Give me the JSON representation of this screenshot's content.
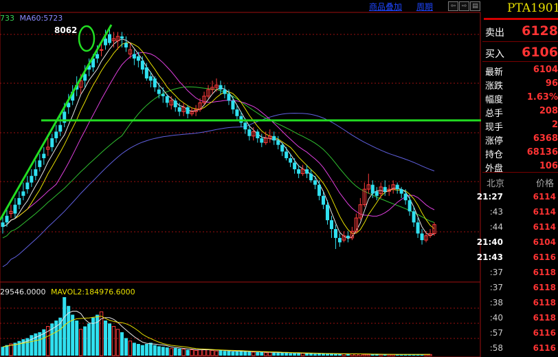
{
  "topbar": {
    "overlay_label": "商品叠加",
    "period_label": "周期",
    "buttons": [
      "⇦",
      "⇨",
      "▤"
    ]
  },
  "price_panel": {
    "ma_legend": {
      "ma_fragment": "733",
      "ma60": "MA60:5723",
      "ma_fragment_color": "#39d353",
      "ma60_color": "#8a8aff"
    },
    "high_label": "8062",
    "horizontal_level_color": "#22dd22"
  },
  "volume_panel": {
    "legend": {
      "vol_fragment": "29546.0000",
      "mavol2": "MAVOL2:184976.6000"
    }
  },
  "sidebar": {
    "symbol": "PTA1901",
    "sell": {
      "label": "卖出",
      "value": "6128"
    },
    "buy": {
      "label": "买入",
      "value": "6106"
    },
    "stats": [
      {
        "label": "最新",
        "value": "6104"
      },
      {
        "label": "涨跌",
        "value": "96"
      },
      {
        "label": "幅度",
        "value": "1.63%"
      },
      {
        "label": "总手",
        "value": "208"
      },
      {
        "label": "现手",
        "value": "2"
      },
      {
        "label": "涨停",
        "value": "6368"
      },
      {
        "label": "持仓",
        "value": "68136"
      },
      {
        "label": "外盘",
        "value": "106"
      }
    ],
    "ticks_header": {
      "left": "北京",
      "right": "价格"
    },
    "ticks": [
      {
        "time": "21:27",
        "price": "6114",
        "bold": true
      },
      {
        "time": ":43",
        "price": "6114",
        "bold": false
      },
      {
        "time": ":44",
        "price": "6114",
        "bold": false
      },
      {
        "time": "21:40",
        "price": "6104",
        "bold": true
      },
      {
        "time": "21:43",
        "price": "6116",
        "bold": true
      },
      {
        "time": ":37",
        "price": "6118",
        "bold": false
      },
      {
        "time": ":37",
        "price": "6118",
        "bold": false
      },
      {
        "time": ":38",
        "price": "6118",
        "bold": false
      },
      {
        "time": ":40",
        "price": "6118",
        "bold": false
      },
      {
        "time": ":57",
        "price": "6116",
        "bold": false
      },
      {
        "time": ":58",
        "price": "6116",
        "bold": false
      }
    ]
  },
  "colors": {
    "up": "#ff3c3c",
    "down": "#30e0f0",
    "ma_white": "#e8e8e8",
    "ma_yellow": "#e8e000",
    "ma_magenta": "#e040e0",
    "ma_green": "#30c030",
    "ma_blue": "#6060e0",
    "grid": "#a01010",
    "annotation": "#22dd22"
  },
  "chart_data": {
    "type": "candlestick",
    "candles": [
      [
        0.12,
        0.1,
        0.15,
        0.07
      ],
      [
        0.15,
        0.12,
        0.18,
        0.1
      ],
      [
        0.16,
        0.17,
        0.2,
        0.14
      ],
      [
        0.2,
        0.16,
        0.23,
        0.14
      ],
      [
        0.23,
        0.2,
        0.26,
        0.18
      ],
      [
        0.26,
        0.24,
        0.3,
        0.22
      ],
      [
        0.3,
        0.27,
        0.33,
        0.25
      ],
      [
        0.33,
        0.3,
        0.36,
        0.28
      ],
      [
        0.36,
        0.33,
        0.4,
        0.31
      ],
      [
        0.4,
        0.37,
        0.43,
        0.35
      ],
      [
        0.43,
        0.41,
        0.46,
        0.38
      ],
      [
        0.45,
        0.46,
        0.5,
        0.42
      ],
      [
        0.5,
        0.46,
        0.52,
        0.44
      ],
      [
        0.53,
        0.5,
        0.56,
        0.48
      ],
      [
        0.56,
        0.53,
        0.6,
        0.51
      ],
      [
        0.62,
        0.57,
        0.66,
        0.55
      ],
      [
        0.66,
        0.64,
        0.7,
        0.61
      ],
      [
        0.71,
        0.67,
        0.74,
        0.65
      ],
      [
        0.74,
        0.72,
        0.78,
        0.69
      ],
      [
        0.73,
        0.76,
        0.79,
        0.7
      ],
      [
        0.79,
        0.76,
        0.83,
        0.73
      ],
      [
        0.83,
        0.81,
        0.86,
        0.78
      ],
      [
        0.86,
        0.82,
        0.88,
        0.8
      ],
      [
        0.88,
        0.86,
        0.92,
        0.84
      ],
      [
        0.9,
        0.9,
        0.94,
        0.87
      ],
      [
        0.95,
        0.92,
        0.99,
        0.9
      ],
      [
        0.97,
        0.93,
        1.0,
        0.92
      ],
      [
        0.94,
        0.95,
        0.98,
        0.91
      ],
      [
        0.94,
        0.96,
        0.98,
        0.9
      ],
      [
        0.96,
        0.95,
        0.98,
        0.91
      ],
      [
        0.93,
        0.91,
        0.96,
        0.89
      ],
      [
        0.88,
        0.9,
        0.93,
        0.86
      ],
      [
        0.88,
        0.86,
        0.9,
        0.83
      ],
      [
        0.87,
        0.85,
        0.89,
        0.82
      ],
      [
        0.85,
        0.81,
        0.87,
        0.79
      ],
      [
        0.82,
        0.77,
        0.84,
        0.76
      ],
      [
        0.78,
        0.76,
        0.8,
        0.73
      ],
      [
        0.77,
        0.73,
        0.78,
        0.71
      ],
      [
        0.72,
        0.7,
        0.75,
        0.68
      ],
      [
        0.7,
        0.69,
        0.73,
        0.66
      ],
      [
        0.69,
        0.66,
        0.7,
        0.64
      ],
      [
        0.65,
        0.67,
        0.69,
        0.63
      ],
      [
        0.67,
        0.64,
        0.68,
        0.62
      ],
      [
        0.64,
        0.62,
        0.66,
        0.6
      ],
      [
        0.62,
        0.64,
        0.66,
        0.6
      ],
      [
        0.64,
        0.61,
        0.65,
        0.59
      ],
      [
        0.61,
        0.62,
        0.64,
        0.6
      ],
      [
        0.62,
        0.63,
        0.65,
        0.6
      ],
      [
        0.63,
        0.66,
        0.68,
        0.62
      ],
      [
        0.66,
        0.69,
        0.71,
        0.65
      ],
      [
        0.69,
        0.72,
        0.74,
        0.68
      ],
      [
        0.72,
        0.73,
        0.76,
        0.7
      ],
      [
        0.73,
        0.74,
        0.77,
        0.71
      ],
      [
        0.74,
        0.72,
        0.76,
        0.7
      ],
      [
        0.72,
        0.7,
        0.74,
        0.68
      ],
      [
        0.7,
        0.67,
        0.72,
        0.65
      ],
      [
        0.67,
        0.63,
        0.69,
        0.61
      ],
      [
        0.63,
        0.6,
        0.65,
        0.58
      ],
      [
        0.6,
        0.57,
        0.62,
        0.55
      ],
      [
        0.57,
        0.54,
        0.59,
        0.52
      ],
      [
        0.54,
        0.51,
        0.56,
        0.49
      ],
      [
        0.51,
        0.53,
        0.55,
        0.49
      ],
      [
        0.53,
        0.5,
        0.54,
        0.48
      ],
      [
        0.5,
        0.48,
        0.52,
        0.46
      ],
      [
        0.48,
        0.5,
        0.53,
        0.47
      ],
      [
        0.5,
        0.51,
        0.54,
        0.48
      ],
      [
        0.51,
        0.49,
        0.53,
        0.47
      ],
      [
        0.49,
        0.47,
        0.51,
        0.45
      ],
      [
        0.47,
        0.44,
        0.48,
        0.42
      ],
      [
        0.44,
        0.41,
        0.46,
        0.4
      ],
      [
        0.41,
        0.39,
        0.43,
        0.37
      ],
      [
        0.39,
        0.36,
        0.41,
        0.34
      ],
      [
        0.36,
        0.34,
        0.38,
        0.32
      ],
      [
        0.34,
        0.36,
        0.38,
        0.33
      ],
      [
        0.36,
        0.34,
        0.38,
        0.32
      ],
      [
        0.34,
        0.31,
        0.36,
        0.3
      ],
      [
        0.31,
        0.29,
        0.33,
        0.27
      ],
      [
        0.29,
        0.24,
        0.31,
        0.22
      ],
      [
        0.24,
        0.2,
        0.26,
        0.18
      ],
      [
        0.2,
        0.13,
        0.22,
        0.11
      ],
      [
        0.13,
        0.09,
        0.15,
        0.05
      ],
      [
        0.09,
        0.05,
        0.11,
        0.0
      ],
      [
        0.05,
        0.03,
        0.07,
        0.01
      ],
      [
        0.04,
        0.06,
        0.08,
        0.03
      ],
      [
        0.06,
        0.05,
        0.08,
        0.03
      ],
      [
        0.05,
        0.08,
        0.1,
        0.04
      ],
      [
        0.08,
        0.14,
        0.16,
        0.07
      ],
      [
        0.14,
        0.2,
        0.23,
        0.13
      ],
      [
        0.2,
        0.27,
        0.3,
        0.19
      ],
      [
        0.27,
        0.29,
        0.34,
        0.25
      ],
      [
        0.29,
        0.25,
        0.31,
        0.23
      ],
      [
        0.26,
        0.24,
        0.28,
        0.22
      ],
      [
        0.25,
        0.28,
        0.3,
        0.23
      ],
      [
        0.28,
        0.26,
        0.31,
        0.24
      ],
      [
        0.26,
        0.27,
        0.29,
        0.24
      ],
      [
        0.27,
        0.29,
        0.31,
        0.25
      ],
      [
        0.29,
        0.27,
        0.3,
        0.25
      ],
      [
        0.27,
        0.25,
        0.28,
        0.23
      ],
      [
        0.25,
        0.22,
        0.27,
        0.2
      ],
      [
        0.22,
        0.17,
        0.24,
        0.15
      ],
      [
        0.17,
        0.12,
        0.19,
        0.1
      ],
      [
        0.12,
        0.07,
        0.14,
        0.05
      ],
      [
        0.07,
        0.04,
        0.09,
        0.02
      ],
      [
        0.04,
        0.06,
        0.08,
        0.03
      ],
      [
        0.06,
        0.07,
        0.09,
        0.05
      ],
      [
        0.07,
        0.11,
        0.12,
        0.06
      ]
    ],
    "volumes": [
      0.15,
      0.18,
      0.2,
      0.22,
      0.25,
      0.28,
      0.3,
      0.35,
      0.38,
      0.4,
      0.45,
      0.5,
      0.55,
      0.6,
      0.65,
      1.0,
      0.85,
      0.7,
      0.6,
      0.45,
      0.5,
      0.55,
      0.65,
      0.7,
      0.75,
      0.6,
      0.55,
      0.5,
      0.45,
      0.4,
      0.3,
      0.25,
      0.22,
      0.2,
      0.18,
      0.2,
      0.22,
      0.18,
      0.16,
      0.15,
      0.14,
      0.12,
      0.13,
      0.12,
      0.11,
      0.1,
      0.1,
      0.09,
      0.1,
      0.11,
      0.1,
      0.09,
      0.08,
      0.09,
      0.08,
      0.08,
      0.07,
      0.07,
      0.08,
      0.07,
      0.07,
      0.06,
      0.06,
      0.06,
      0.05,
      0.06,
      0.05,
      0.05,
      0.05,
      0.05,
      0.04,
      0.04,
      0.04,
      0.04,
      0.04,
      0.04,
      0.03,
      0.04,
      0.03,
      0.03,
      0.03,
      0.03,
      0.03,
      0.03,
      0.03,
      0.03,
      0.03,
      0.03,
      0.02,
      0.02,
      0.02,
      0.02,
      0.02,
      0.02,
      0.02,
      0.02,
      0.02,
      0.02,
      0.02,
      0.02,
      0.02,
      0.02,
      0.02,
      0.02,
      0.02
    ],
    "horizontal_level_rel": 0.73
  }
}
